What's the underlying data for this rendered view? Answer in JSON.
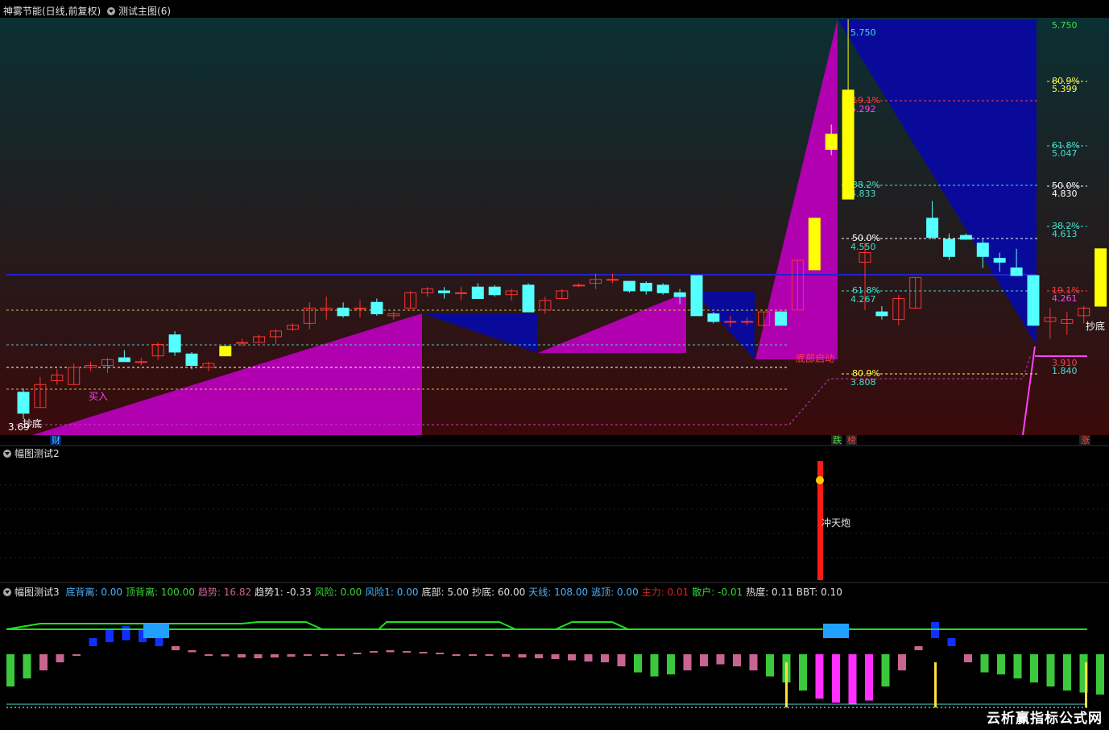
{
  "main_panel": {
    "stock": "神雾节能(日线,前复权)",
    "indicator": "测试主图(6)",
    "bottom_tags": [
      "财",
      "跌",
      "榜",
      "涨"
    ]
  },
  "sub_panel_2": {
    "title": "幅图测试2",
    "signal_label": "冲天炮"
  },
  "sub_panel_3": {
    "title": "幅图测试3",
    "stats": [
      {
        "name": "底背离:",
        "value": "0.00",
        "color": "#4ab2ff"
      },
      {
        "name": "顶背离:",
        "value": "100.00",
        "color": "#38d838"
      },
      {
        "name": "趋势:",
        "value": "16.82",
        "color": "#c86490"
      },
      {
        "name": "趋势1:",
        "value": "-0.33",
        "color": "#e0e0e0"
      },
      {
        "name": "风险:",
        "value": "0.00",
        "color": "#38d838"
      },
      {
        "name": "风险1:",
        "value": "0.00",
        "color": "#4ab2ff"
      },
      {
        "name": "底部:",
        "value": "5.00",
        "color": "#e0e0e0"
      },
      {
        "name": "抄底:",
        "value": "60.00",
        "color": "#e0e0e0"
      },
      {
        "name": "天线:",
        "value": "108.00",
        "color": "#4ab2ff"
      },
      {
        "name": "逃顶:",
        "value": "0.00",
        "color": "#4ab2ff"
      },
      {
        "name": "主力:",
        "value": "0.01",
        "color": "#e02020"
      },
      {
        "name": "散户:",
        "value": "-0.01",
        "color": "#38d838"
      },
      {
        "name": "热度:",
        "value": "0.11",
        "color": "#e0e0e0"
      },
      {
        "name": "BBT:",
        "value": "0.10",
        "color": "#e0e0e0"
      }
    ]
  },
  "watermark": "云析赢指标公式网",
  "chart_data": [
    {
      "type": "candlestick",
      "candles": [
        {
          "o": 3.8,
          "h": 3.82,
          "l": 3.66,
          "c": 3.69
        },
        {
          "o": 3.72,
          "h": 3.88,
          "l": 3.72,
          "c": 3.84
        },
        {
          "o": 3.86,
          "h": 3.92,
          "l": 3.84,
          "c": 3.89
        },
        {
          "o": 3.84,
          "h": 3.95,
          "l": 3.84,
          "c": 3.93
        },
        {
          "o": 3.93,
          "h": 3.96,
          "l": 3.91,
          "c": 3.94
        },
        {
          "o": 3.94,
          "h": 3.98,
          "l": 3.9,
          "c": 3.97
        },
        {
          "o": 3.98,
          "h": 4.02,
          "l": 3.96,
          "c": 3.96
        },
        {
          "o": 3.96,
          "h": 3.98,
          "l": 3.94,
          "c": 3.96
        },
        {
          "o": 3.99,
          "h": 4.06,
          "l": 3.97,
          "c": 4.05
        },
        {
          "o": 4.1,
          "h": 4.12,
          "l": 3.99,
          "c": 4.01
        },
        {
          "o": 4.0,
          "h": 4.01,
          "l": 3.92,
          "c": 3.94
        },
        {
          "o": 3.93,
          "h": 3.96,
          "l": 3.91,
          "c": 3.95
        },
        {
          "o": 3.99,
          "h": 4.04,
          "l": 3.99,
          "c": 4.04
        },
        {
          "o": 4.06,
          "h": 4.08,
          "l": 4.04,
          "c": 4.06
        },
        {
          "o": 4.06,
          "h": 4.1,
          "l": 4.06,
          "c": 4.09
        },
        {
          "o": 4.09,
          "h": 4.13,
          "l": 4.05,
          "c": 4.12
        },
        {
          "o": 4.13,
          "h": 4.16,
          "l": 4.12,
          "c": 4.15
        },
        {
          "o": 4.16,
          "h": 4.27,
          "l": 4.13,
          "c": 4.24
        },
        {
          "o": 4.23,
          "h": 4.3,
          "l": 4.18,
          "c": 4.24
        },
        {
          "o": 4.24,
          "h": 4.27,
          "l": 4.19,
          "c": 4.2
        },
        {
          "o": 4.24,
          "h": 4.28,
          "l": 4.19,
          "c": 4.24
        },
        {
          "o": 4.27,
          "h": 4.29,
          "l": 4.2,
          "c": 4.21
        },
        {
          "o": 4.2,
          "h": 4.22,
          "l": 4.18,
          "c": 4.21
        },
        {
          "o": 4.24,
          "h": 4.33,
          "l": 4.24,
          "c": 4.32
        },
        {
          "o": 4.32,
          "h": 4.35,
          "l": 4.3,
          "c": 4.34
        },
        {
          "o": 4.33,
          "h": 4.35,
          "l": 4.29,
          "c": 4.32
        },
        {
          "o": 4.32,
          "h": 4.35,
          "l": 4.28,
          "c": 4.32
        },
        {
          "o": 4.35,
          "h": 4.37,
          "l": 4.29,
          "c": 4.29
        },
        {
          "o": 4.35,
          "h": 4.36,
          "l": 4.3,
          "c": 4.31
        },
        {
          "o": 4.31,
          "h": 4.34,
          "l": 4.28,
          "c": 4.33
        },
        {
          "o": 4.36,
          "h": 4.37,
          "l": 4.22,
          "c": 4.22
        },
        {
          "o": 4.23,
          "h": 4.3,
          "l": 4.21,
          "c": 4.28
        },
        {
          "o": 4.29,
          "h": 4.34,
          "l": 4.29,
          "c": 4.33
        },
        {
          "o": 4.36,
          "h": 4.37,
          "l": 4.35,
          "c": 4.36
        },
        {
          "o": 4.37,
          "h": 4.42,
          "l": 4.34,
          "c": 4.39
        },
        {
          "o": 4.39,
          "h": 4.42,
          "l": 4.37,
          "c": 4.39
        },
        {
          "o": 4.38,
          "h": 4.38,
          "l": 4.32,
          "c": 4.33
        },
        {
          "o": 4.37,
          "h": 4.38,
          "l": 4.31,
          "c": 4.33
        },
        {
          "o": 4.36,
          "h": 4.37,
          "l": 4.31,
          "c": 4.32
        },
        {
          "o": 4.32,
          "h": 4.34,
          "l": 4.26,
          "c": 4.3
        },
        {
          "o": 4.41,
          "h": 4.41,
          "l": 4.2,
          "c": 4.2
        },
        {
          "o": 4.21,
          "h": 4.22,
          "l": 4.16,
          "c": 4.17
        },
        {
          "o": 4.17,
          "h": 4.2,
          "l": 4.14,
          "c": 4.17
        },
        {
          "o": 4.17,
          "h": 4.19,
          "l": 4.15,
          "c": 4.17
        },
        {
          "o": 4.15,
          "h": 4.22,
          "l": 4.14,
          "c": 4.22
        },
        {
          "o": 4.22,
          "h": 4.22,
          "l": 4.15,
          "c": 4.15
        },
        {
          "o": 4.23,
          "h": 4.49,
          "l": 4.23,
          "c": 4.49
        },
        {
          "o": 4.44,
          "h": 4.71,
          "l": 4.44,
          "c": 4.71
        },
        {
          "o": 5.15,
          "h": 5.2,
          "l": 5.04,
          "c": 5.07
        },
        {
          "o": 4.81,
          "h": 5.75,
          "l": 4.81,
          "c": 5.38
        },
        {
          "o": 4.48,
          "h": 4.58,
          "l": 4.23,
          "c": 4.53
        },
        {
          "o": 4.22,
          "h": 4.25,
          "l": 4.18,
          "c": 4.2
        },
        {
          "o": 4.18,
          "h": 4.31,
          "l": 4.15,
          "c": 4.29
        },
        {
          "o": 4.24,
          "h": 4.4,
          "l": 4.24,
          "c": 4.4
        },
        {
          "o": 4.71,
          "h": 4.8,
          "l": 4.6,
          "c": 4.61
        },
        {
          "o": 4.6,
          "h": 4.63,
          "l": 4.49,
          "c": 4.51
        },
        {
          "o": 4.62,
          "h": 4.63,
          "l": 4.6,
          "c": 4.6
        },
        {
          "o": 4.58,
          "h": 4.6,
          "l": 4.45,
          "c": 4.51
        },
        {
          "o": 4.5,
          "h": 4.53,
          "l": 4.43,
          "c": 4.48
        },
        {
          "o": 4.45,
          "h": 4.55,
          "l": 4.41,
          "c": 4.41
        },
        {
          "o": 4.41,
          "h": 4.41,
          "l": 4.15,
          "c": 4.15
        },
        {
          "o": 4.17,
          "h": 4.24,
          "l": 4.08,
          "c": 4.19
        },
        {
          "o": 4.16,
          "h": 4.22,
          "l": 4.1,
          "c": 4.18
        },
        {
          "o": 4.2,
          "h": 4.25,
          "l": 4.16,
          "c": 4.24
        },
        {
          "o": 4.25,
          "h": 4.55,
          "l": 4.25,
          "c": 4.55
        }
      ],
      "fib_labels": [
        {
          "pct": "19.1%",
          "price": "5.292"
        },
        {
          "pct": "38.2%",
          "price": "4.833"
        },
        {
          "pct": "50.0%",
          "price": "4.550"
        },
        {
          "pct": "61.8%",
          "price": "4.267"
        },
        {
          "pct": "80.9%",
          "price": "3.808"
        },
        {
          "pct": "",
          "price": "5.750"
        }
      ],
      "fib_labels_right": [
        {
          "pct": "",
          "price": "5.750"
        },
        {
          "pct": "80.9%",
          "price": "5.399"
        },
        {
          "pct": "61.8%",
          "price": "5.047"
        },
        {
          "pct": "50.0%",
          "price": "4.830"
        },
        {
          "pct": "38.2%",
          "price": "4.613"
        },
        {
          "pct": "19.1%",
          "price": "4.261"
        },
        {
          "pct": "",
          "price": "3.910"
        },
        {
          "pct": "",
          "price": "1.840"
        }
      ],
      "annotations": [
        "抄底",
        "买入",
        "底部启动",
        "抄底",
        "3.69"
      ]
    },
    {
      "type": "bar",
      "name": "幅图测试3",
      "values": [
        -80,
        -60,
        -40,
        -20,
        0,
        20,
        30,
        35,
        30,
        20,
        10,
        5,
        0,
        -5,
        -8,
        -10,
        -8,
        -6,
        -4,
        -2,
        0,
        2,
        4,
        5,
        4,
        3,
        2,
        0,
        -2,
        -4,
        -6,
        -8,
        -10,
        -12,
        -15,
        -18,
        -20,
        -30,
        -45,
        -55,
        -50,
        -40,
        -30,
        -25,
        -30,
        -40,
        -55,
        -70,
        -90,
        -110,
        -120,
        -125,
        -115,
        -80,
        -40,
        10,
        40,
        20,
        -20,
        -45,
        -50,
        -60,
        -70,
        -80,
        -90,
        -95,
        -100,
        -100,
        -100,
        -100
      ]
    }
  ]
}
